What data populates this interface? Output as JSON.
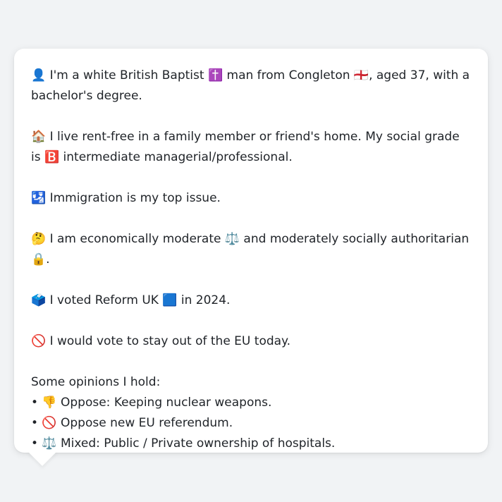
{
  "profile": {
    "line1": "👤 I'm a white British Baptist ✝️ man from Congleton 🏴󠁧󠁢󠁥󠁮󠁧󠁿, aged 37, with a bachelor's degree.",
    "line2": "🏠 I live rent-free in a family member or friend's home. My social grade is 🅱️ intermediate managerial/professional.",
    "line3": "🛂 Immigration is my top issue.",
    "line4": "🤔 I am economically moderate ⚖️ and moderately socially authoritarian 🔒.",
    "line5": "🗳️ I voted Reform UK 🟦 in 2024.",
    "line6": "🚫 I would vote to stay out of the EU today.",
    "opinions_heading": "Some opinions I hold:",
    "opinions": [
      "• 👎 Oppose: Keeping nuclear weapons.",
      "• 🚫 Oppose new EU referendum.",
      "• ⚖️ Mixed: Public / Private ownership of hospitals."
    ]
  }
}
